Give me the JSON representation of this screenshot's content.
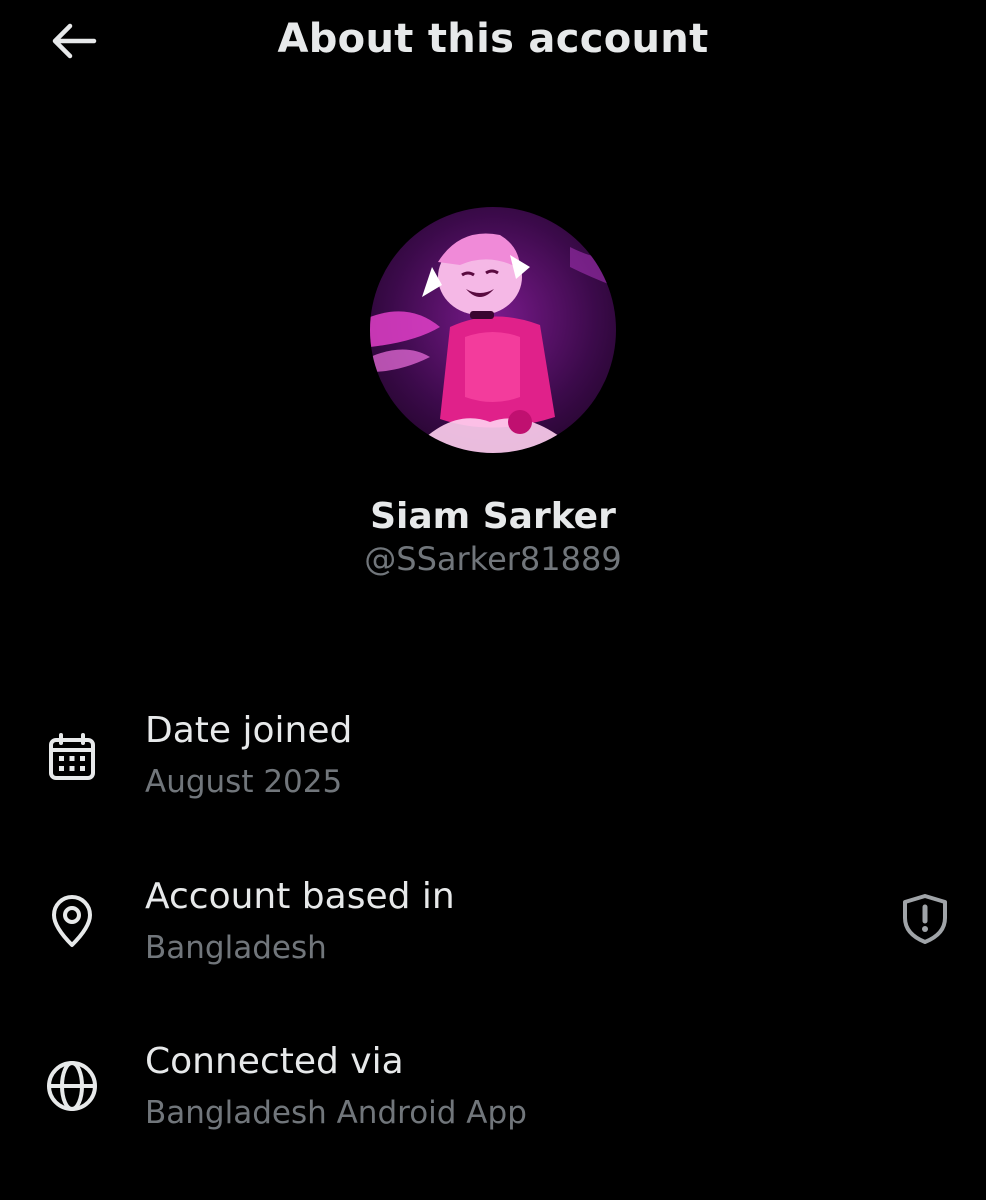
{
  "header": {
    "title": "About this account",
    "back_icon": "arrow-left-icon"
  },
  "profile": {
    "display_name": "Siam Sarker",
    "handle": "@SSarker81889",
    "avatar_icon": "profile-avatar"
  },
  "rows": [
    {
      "icon": "calendar-icon",
      "label": "Date joined",
      "value": "August 2025"
    },
    {
      "icon": "location-pin-icon",
      "label": "Account based in",
      "value": "Bangladesh",
      "action_icon": "shield-alert-icon"
    },
    {
      "icon": "globe-icon",
      "label": "Connected via",
      "value": "Bangladesh Android App"
    }
  ],
  "colors": {
    "background": "#000000",
    "text_primary": "#e7e9ea",
    "text_secondary": "#71767b",
    "avatar_accent": "#e0218a"
  }
}
